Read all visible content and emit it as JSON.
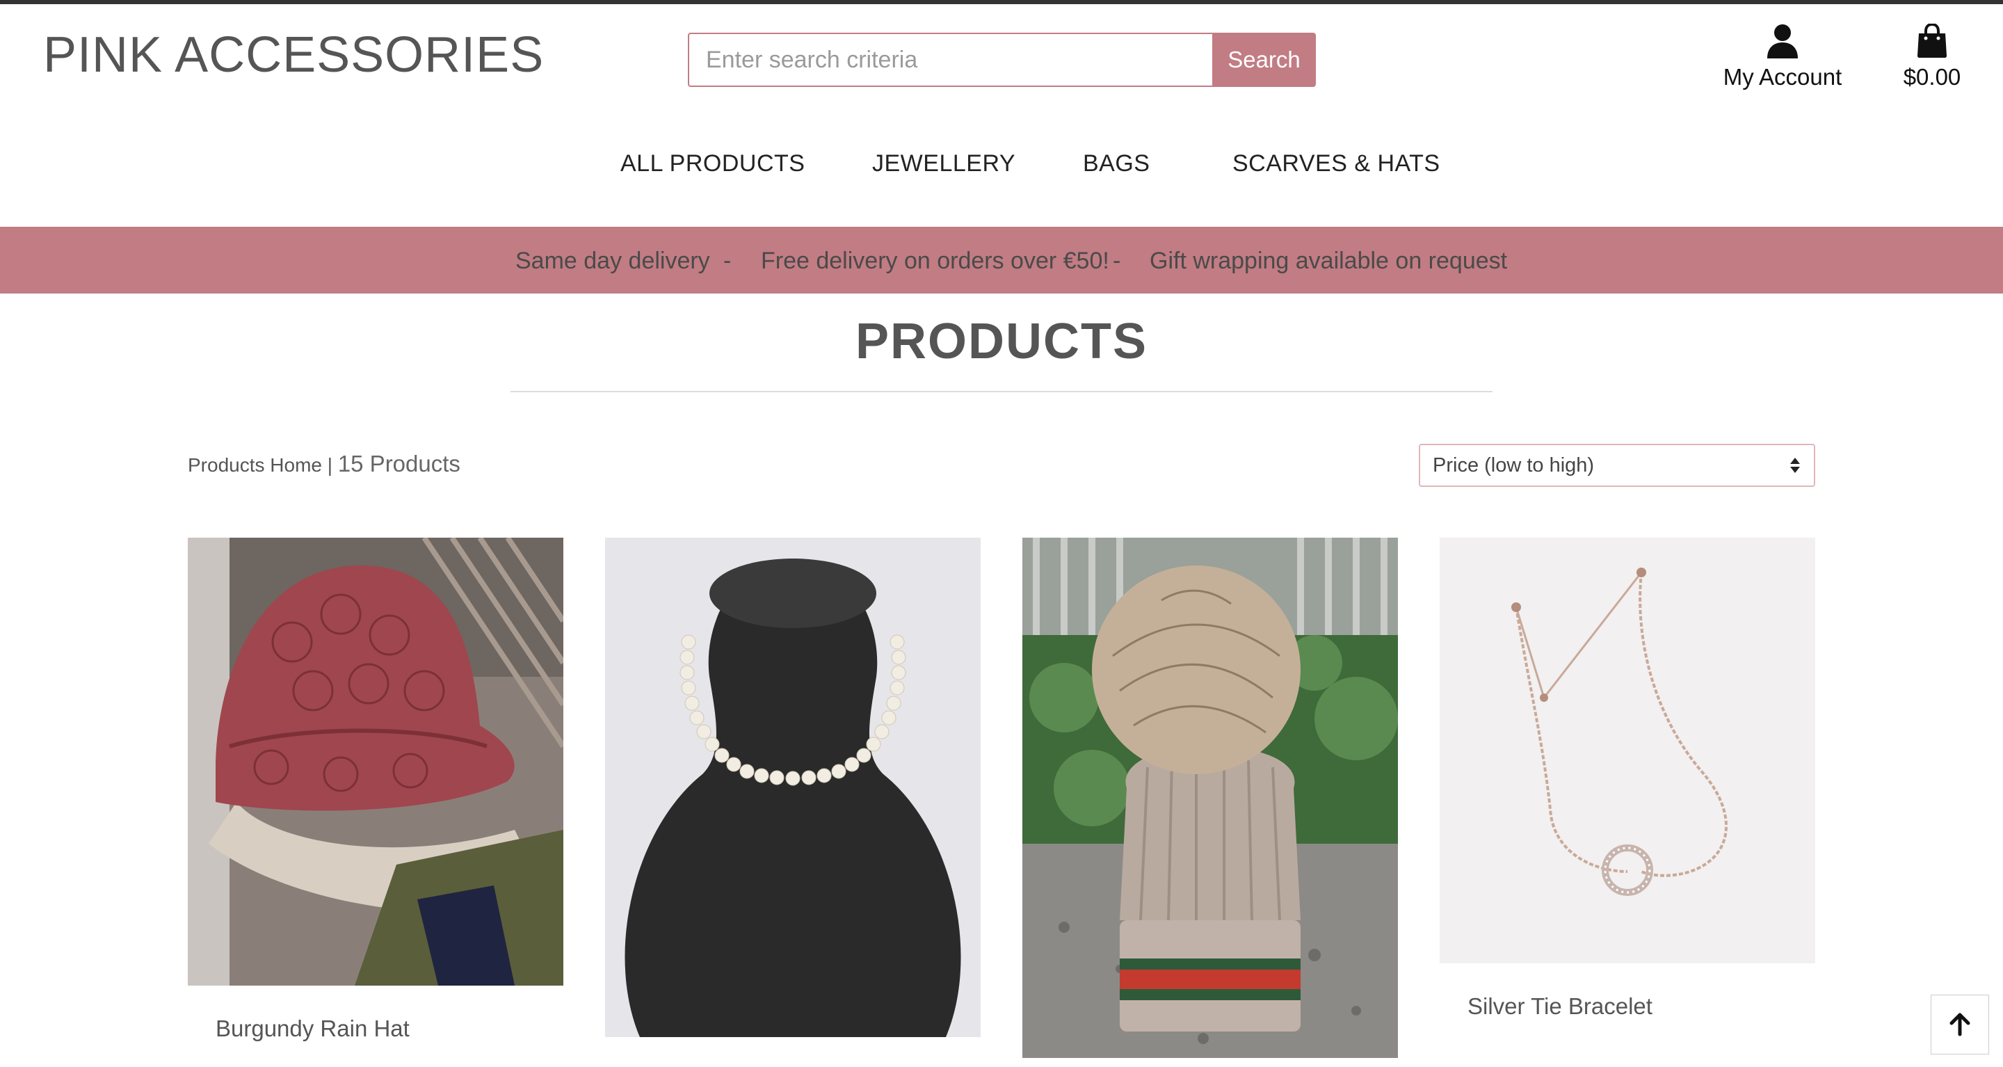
{
  "header": {
    "brand": "PINK ACCESSORIES",
    "search": {
      "placeholder": "Enter search criteria",
      "button_label": "Search"
    },
    "account_label": "My Account",
    "cart_total": "$0.00"
  },
  "nav": {
    "items": [
      {
        "label": "ALL PRODUCTS"
      },
      {
        "label": "JEWELLERY"
      },
      {
        "label": "BAGS"
      },
      {
        "label": "SCARVES & HATS"
      }
    ]
  },
  "banner": {
    "messages": [
      "Same day delivery",
      "Free delivery on orders over €50!",
      "Gift wrapping available on request"
    ],
    "separator": "-"
  },
  "main": {
    "title": "PRODUCTS",
    "breadcrumb_link": "Products Home",
    "breadcrumb_sep": "|",
    "product_count": "15 Products",
    "sort": {
      "selected": "Price (low to high)"
    }
  },
  "products": [
    {
      "name": "Burgundy Rain Hat",
      "image": "burgundy-quilted-bucket-hat-photo"
    },
    {
      "name": "",
      "image": "pearl-necklace-on-black-bust-photo"
    },
    {
      "name": "",
      "image": "beige-knit-pompom-beanie-photo"
    },
    {
      "name": "Silver Tie Bracelet",
      "image": "silver-adjustable-bracelet-photo"
    }
  ],
  "colors": {
    "accent": "#c27c84",
    "text": "#555555",
    "dark": "#333333"
  },
  "icons": {
    "account": "user-icon",
    "cart": "shopping-bag-icon",
    "sort": "sort-caret-icon",
    "back_to_top": "arrow-up-icon"
  }
}
